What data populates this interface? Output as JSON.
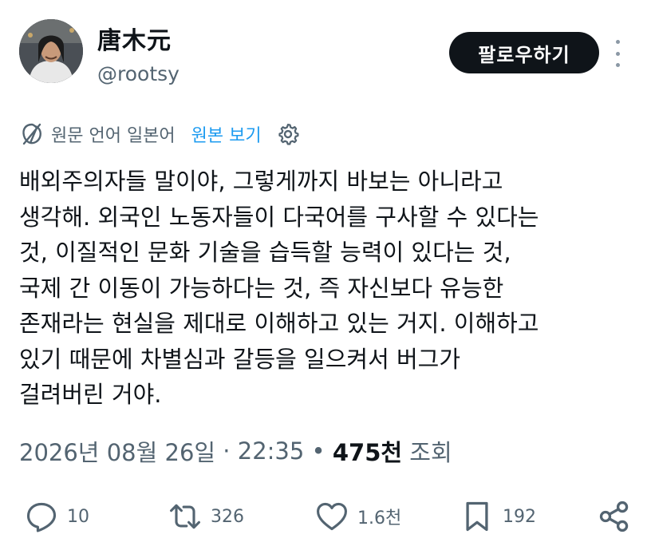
{
  "author": {
    "display_name": "唐木元",
    "handle": "@rootsy"
  },
  "follow_button": {
    "label": "팔로우하기"
  },
  "translation": {
    "language_label": "원문 언어 일본어",
    "view_original_label": "원본 보기"
  },
  "tweet": {
    "text": "배외주의자들 말이야, 그렇게까지 바보는 아니라고\n생각해. 외국인 노동자들이 다국어를 구사할 수 있다는\n것, 이질적인 문화 기술을 습득할 능력이 있다는 것,\n국제 간 이동이 가능하다는 것, 즉 자신보다 유능한\n존재라는 현실을 제대로 이해하고 있는 거지. 이해하고\n있기 때문에 차별심과 갈등을 일으켜서 버그가\n걸려버린 거야."
  },
  "meta": {
    "date": "2026년 08월 26일",
    "separator1": " · ",
    "time": "22:35",
    "separator2": " • ",
    "views_count": "475천",
    "views_label": " 조회"
  },
  "actions": {
    "reply_count": "10",
    "retweet_count": "326",
    "like_count": "1.6천",
    "bookmark_count": "192"
  },
  "icons": [
    "more-vertical-icon",
    "translate-off-icon",
    "gear-icon",
    "reply-icon",
    "retweet-icon",
    "like-icon",
    "bookmark-icon",
    "share-icon"
  ],
  "colors": {
    "link": "#1d9bf0",
    "text": "#0f1419",
    "secondary": "#536471",
    "button_bg": "#0f1419"
  }
}
